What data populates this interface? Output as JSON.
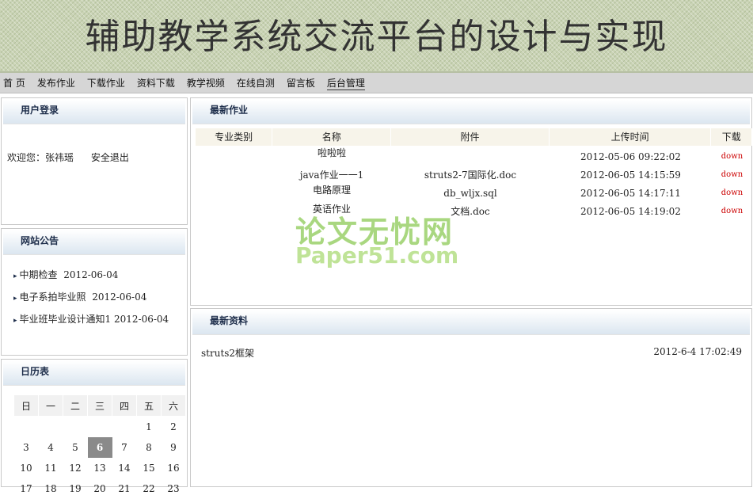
{
  "header": {
    "title": "辅助教学系统交流平台的设计与实现"
  },
  "nav": {
    "items": [
      "首 页",
      "发布作业",
      "下载作业",
      "资料下载",
      "教学视频",
      "在线自测",
      "留言板",
      "后台管理"
    ]
  },
  "login": {
    "title": "用户登录",
    "welcome": "欢迎您：张祎瑶",
    "logout": "安全退出"
  },
  "notices": {
    "title": "网站公告",
    "items": [
      {
        "text": "中期检查",
        "date": "2012-06-04"
      },
      {
        "text": "电子系拍毕业照",
        "date": "2012-06-04"
      },
      {
        "text": "毕业班毕业设计通知1",
        "date": "2012-06-04"
      }
    ]
  },
  "calendar": {
    "title": "日历表",
    "weekdays": [
      "日",
      "一",
      "二",
      "三",
      "四",
      "五",
      "六"
    ],
    "rows": [
      [
        "",
        "",
        "",
        "",
        "",
        "1",
        "2"
      ],
      [
        "3",
        "4",
        "5",
        "6",
        "7",
        "8",
        "9"
      ],
      [
        "10",
        "11",
        "12",
        "13",
        "14",
        "15",
        "16"
      ],
      [
        "17",
        "18",
        "19",
        "20",
        "21",
        "22",
        "23"
      ]
    ],
    "today": "6"
  },
  "homework": {
    "title": "最新作业",
    "columns": [
      "专业类别",
      "名称",
      "附件",
      "上传时间",
      "下载"
    ],
    "rows": [
      {
        "category": "",
        "name": "啦啦啦",
        "file": "",
        "time": "2012-05-06 09:22:02",
        "download": "down"
      },
      {
        "category": "",
        "name": "java作业一一1",
        "file": "struts2-7国际化.doc",
        "time": "2012-06-05 14:15:59",
        "download": "down"
      },
      {
        "category": "",
        "name": "电路原理",
        "file": "db_wljx.sql",
        "time": "2012-06-05 14:17:11",
        "download": "down"
      },
      {
        "category": "",
        "name": "英语作业",
        "file": "文档.doc",
        "time": "2012-06-05 14:19:02",
        "download": "down"
      }
    ]
  },
  "resources": {
    "title": "最新资料",
    "items": [
      {
        "name": "struts2框架",
        "time": "2012-6-4 17:02:49"
      }
    ]
  },
  "watermark": {
    "line1": "论文无忧网",
    "line2": "Paper51.com"
  }
}
